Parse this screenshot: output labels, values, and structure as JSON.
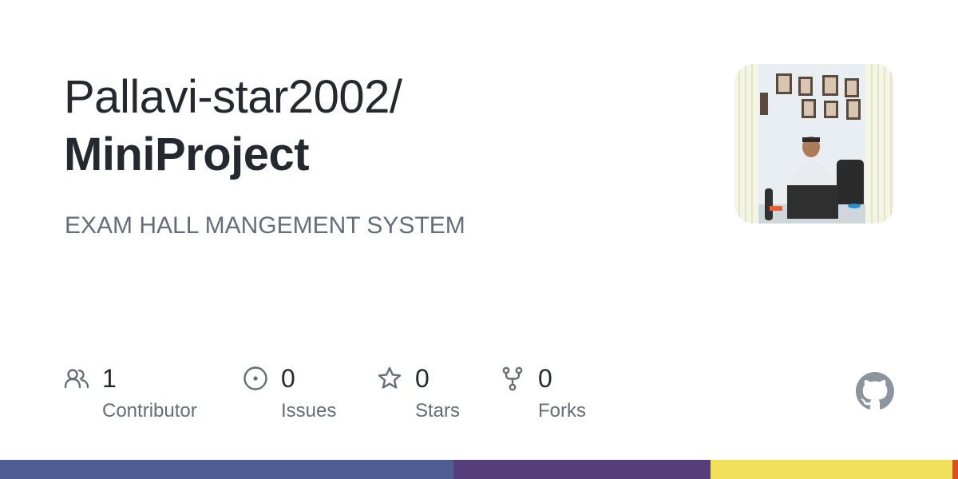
{
  "repository": {
    "owner": "Pallavi-star2002/",
    "name": "MiniProject",
    "description": "EXAM HALL MANGEMENT SYSTEM"
  },
  "avatar": {
    "icon": "owner-avatar-photo"
  },
  "stats": [
    {
      "count": "1",
      "label": "Contributor",
      "icon": "people-icon"
    },
    {
      "count": "0",
      "label": "Issues",
      "icon": "issue-circle-icon"
    },
    {
      "count": "0",
      "label": "Stars",
      "icon": "star-icon"
    },
    {
      "count": "0",
      "label": "Forks",
      "icon": "fork-icon"
    }
  ],
  "language_bar": [
    {
      "color": "#4F5D95",
      "fraction": 0.473
    },
    {
      "color": "#563d7c",
      "fraction": 0.269
    },
    {
      "color": "#f1e05a",
      "fraction": 0.252
    },
    {
      "color": "#e34c26",
      "fraction": 0.006
    }
  ],
  "colors": {
    "text_primary": "#24292f",
    "text_secondary": "#656d76",
    "icon": "#656d76"
  }
}
